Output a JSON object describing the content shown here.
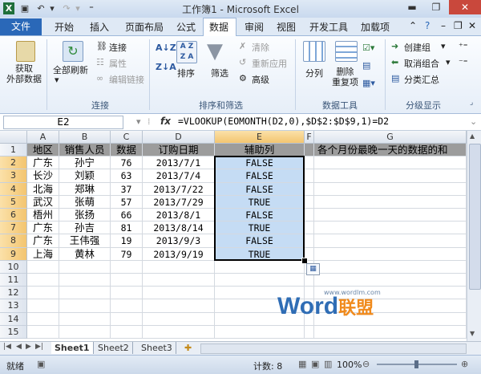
{
  "window": {
    "title": "工作簿1 - Microsoft Excel"
  },
  "tabs": {
    "file": "文件",
    "home": "开始",
    "insert": "插入",
    "layout": "页面布局",
    "formulas": "公式",
    "data": "数据",
    "review": "审阅",
    "view": "视图",
    "developer": "开发工具",
    "addins": "加载项"
  },
  "ribbon": {
    "get_external": "获取\n外部数据",
    "refresh_all": "全部刷新",
    "connections": "连接",
    "properties": "属性",
    "edit_links": "编辑链接",
    "group_connections": "连接",
    "sort": "排序",
    "filter": "筛选",
    "clear": "清除",
    "reapply": "重新应用",
    "advanced": "高级",
    "group_sort_filter": "排序和筛选",
    "text_to_columns": "分列",
    "remove_duplicates": "删除\n重复项",
    "group_data_tools": "数据工具",
    "group": "创建组",
    "ungroup": "取消组合",
    "subtotal": "分类汇总",
    "group_outline": "分级显示"
  },
  "formula_bar": {
    "name_box": "E2",
    "fx": "fx",
    "formula": "=VLOOKUP(EOMONTH(D2,0),$D$2:$D$9,1)=D2"
  },
  "columns": [
    "A",
    "B",
    "C",
    "D",
    "E",
    "F",
    "G"
  ],
  "rows": [
    "1",
    "2",
    "3",
    "4",
    "5",
    "6",
    "7",
    "8",
    "9",
    "10",
    "11",
    "12",
    "13",
    "14",
    "15"
  ],
  "table": {
    "headers": [
      "地区",
      "销售人员",
      "数据",
      "订购日期",
      "辅助列"
    ],
    "g1": "各个月份最晚一天的数据的和",
    "data": [
      [
        "广东",
        "孙宁",
        "76",
        "2013/7/1",
        "FALSE"
      ],
      [
        "长沙",
        "刘颖",
        "63",
        "2013/7/4",
        "FALSE"
      ],
      [
        "北海",
        "郑琳",
        "37",
        "2013/7/22",
        "FALSE"
      ],
      [
        "武汉",
        "张萌",
        "57",
        "2013/7/29",
        "TRUE"
      ],
      [
        "梧州",
        "张扬",
        "66",
        "2013/8/1",
        "FALSE"
      ],
      [
        "广东",
        "孙吉",
        "81",
        "2013/8/14",
        "TRUE"
      ],
      [
        "广东",
        "王伟强",
        "19",
        "2013/9/3",
        "FALSE"
      ],
      [
        "上海",
        "黄林",
        "79",
        "2013/9/19",
        "TRUE"
      ]
    ]
  },
  "watermark": {
    "word": "Word",
    "cn": "联盟",
    "url": "www.wordlm.com"
  },
  "sheets": [
    "Sheet1",
    "Sheet2",
    "Sheet3"
  ],
  "status": {
    "ready": "就绪",
    "count": "计数: 8",
    "zoom": "100%"
  },
  "colors": {
    "file_tab": "#2a68b8",
    "selection": "#c5dcf4",
    "header_fill": "#9c9c9c"
  }
}
